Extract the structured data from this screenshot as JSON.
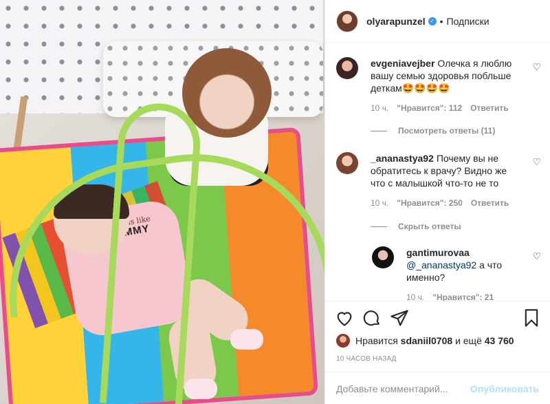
{
  "header": {
    "username": "olyarapunzel",
    "dot": "•",
    "follow_label": "Подписки"
  },
  "comments": [
    {
      "username": "evgeniavejber",
      "text": "Олечка я люблю вашу семью здоровья побльше деткам🤩🤩🤩🤩",
      "time": "10 ч.",
      "likes": "\"Нравится\": 112",
      "reply": "Ответить",
      "replies_toggle": "Посмотреть ответы (11)"
    },
    {
      "username": "_ananastya92",
      "text": "Почему вы не обратитесь к врачу? Видно же что с малышкой что-то не то",
      "time": "10 ч.",
      "likes": "\"Нравится\": 250",
      "reply": "Ответить",
      "replies_toggle": "Скрыть ответы"
    },
    {
      "username": "gantimurovaa",
      "mention": "@_ananastya92",
      "text": "а что именно?",
      "time": "10 ч.",
      "likes": "\"Нравится\": 21"
    }
  ],
  "likes": {
    "prefix": "Нравится",
    "user": "sdaniil0708",
    "middle": "и ещё",
    "count": "43 760"
  },
  "timestamp": "10 ЧАСОВ НАЗАД",
  "add_comment": {
    "placeholder": "Добавьте комментарий...",
    "post_label": "Опубликовать"
  },
  "photo": {
    "shirt_script": "fabulous like",
    "shirt_word": "MOMMY"
  },
  "colors": {
    "link": "#00376b",
    "verified": "#3897f0",
    "post_disabled": "#b2dffc",
    "muted": "#8e8e8e"
  }
}
